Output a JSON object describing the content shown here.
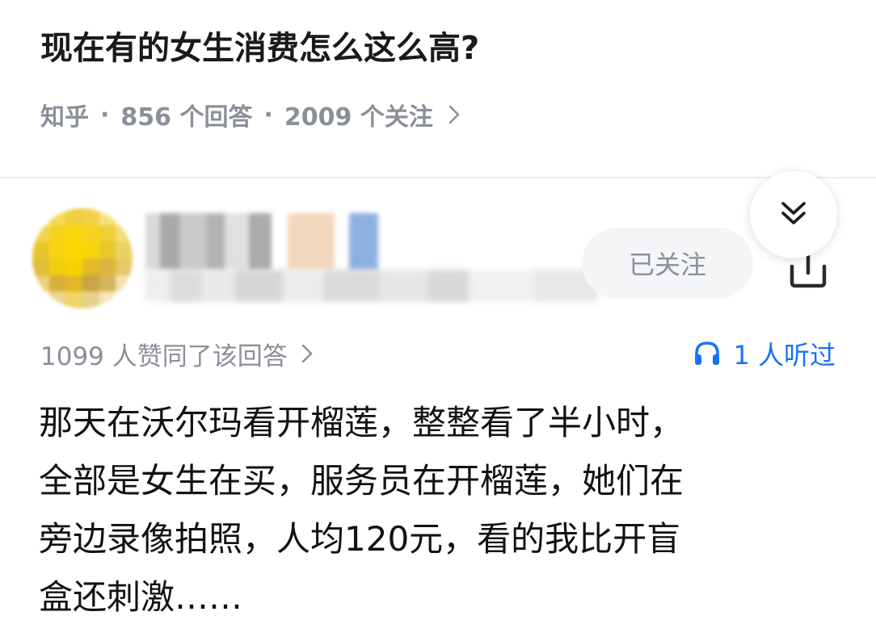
{
  "question": {
    "title": "现在有的女生消费怎么这么高?",
    "source": "知乎",
    "separator": "·",
    "answers": "856 个回答",
    "followers": "2009 个关注"
  },
  "answer": {
    "follow_label": "已关注",
    "upvotes": "1099 人赞同了该回答",
    "listened": "1 人听过",
    "content_lines": [
      "那天在沃尔玛看开榴莲，整整看了半小时，",
      "全部是女生在买，服务员在开榴莲，她们在",
      "旁边录像拍照，人均120元，看的我比开盲",
      "盒还刺激……"
    ]
  },
  "icons": {
    "meta_chevron": "chevron-right-icon",
    "upvote_chevron": "chevron-right-icon",
    "listen": "headphones-icon",
    "share": "share-icon",
    "collapse": "double-chevron-down-icon"
  },
  "colors": {
    "accent": "#1772f6",
    "muted": "#8a8f99",
    "text": "#121212",
    "button_bg": "#f4f5f7"
  }
}
